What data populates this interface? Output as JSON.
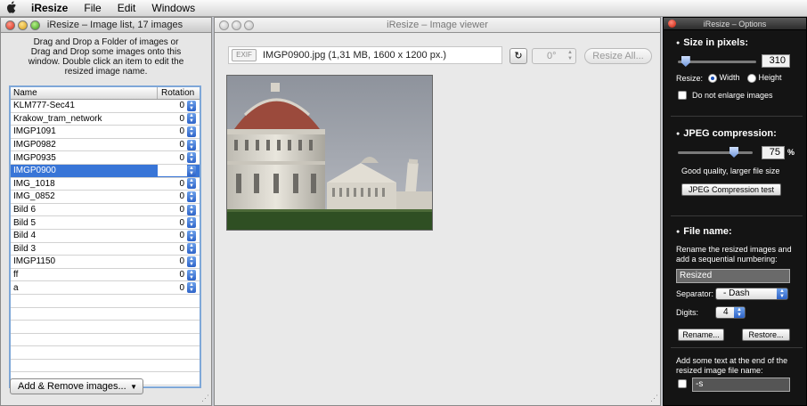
{
  "menubar": {
    "apple": "",
    "items": [
      "iResize",
      "File",
      "Edit",
      "Windows"
    ]
  },
  "list_window": {
    "title": "iResize – Image list, 17 images",
    "hint": "Drag and Drop a Folder of images or Drag and Drop some images onto this window. Double click an item to edit the resized image name.",
    "columns": [
      "Name",
      "Rotation"
    ],
    "rows": [
      {
        "name": "KLM777-Sec41",
        "rotation": "0"
      },
      {
        "name": "Krakow_tram_network",
        "rotation": "0"
      },
      {
        "name": "IMGP1091",
        "rotation": "0"
      },
      {
        "name": "IMGP0982",
        "rotation": "0"
      },
      {
        "name": "IMGP0935",
        "rotation": "0"
      },
      {
        "name": "IMGP0900",
        "rotation": "",
        "selected": true
      },
      {
        "name": "IMG_1018",
        "rotation": "0"
      },
      {
        "name": "IMG_0852",
        "rotation": "0"
      },
      {
        "name": "Bild 6",
        "rotation": "0"
      },
      {
        "name": "Bild 5",
        "rotation": "0"
      },
      {
        "name": "Bild 4",
        "rotation": "0"
      },
      {
        "name": "Bild 3",
        "rotation": "0"
      },
      {
        "name": "IMGP1150",
        "rotation": "0"
      },
      {
        "name": "ff",
        "rotation": "0"
      },
      {
        "name": "a",
        "rotation": "0"
      }
    ],
    "add_button": "Add & Remove images..."
  },
  "viewer_window": {
    "title": "iResize – Image viewer",
    "exif_label": "EXIF",
    "file_info": "IMGP0900.jpg  (1,31 MB, 1600 x 1200 px.)",
    "rotation_value": "0°",
    "resize_all": "Resize All..."
  },
  "options": {
    "title": "iResize – Options",
    "size_section": "Size in pixels:",
    "size_value": "310",
    "size_slider_fraction": 0.1,
    "resize_label": "Resize:",
    "width_label": "Width",
    "height_label": "Height",
    "resize_selected": "Width",
    "no_enlarge": "Do not enlarge images",
    "jpeg_section": "JPEG compression:",
    "jpeg_value": "75",
    "jpeg_unit": "%",
    "jpeg_slider_fraction": 0.75,
    "quality_text": "Good quality, larger file size",
    "jpeg_test_button": "JPEG Compression test",
    "file_section": "File name:",
    "file_desc": "Rename the resized images and add a sequential numbering:",
    "file_value": "Resized",
    "separator_label": "Separator:",
    "separator_value": "- Dash",
    "digits_label": "Digits:",
    "digits_value": "4",
    "rename_button": "Rename...",
    "restore_button": "Restore...",
    "suffix_desc": "Add some text at the end of the resized image file name:",
    "suffix_value": "-s"
  },
  "colors": {
    "selection": "#3875d7",
    "hud_background": "#141414",
    "focus_ring": "#7ea7d8"
  }
}
